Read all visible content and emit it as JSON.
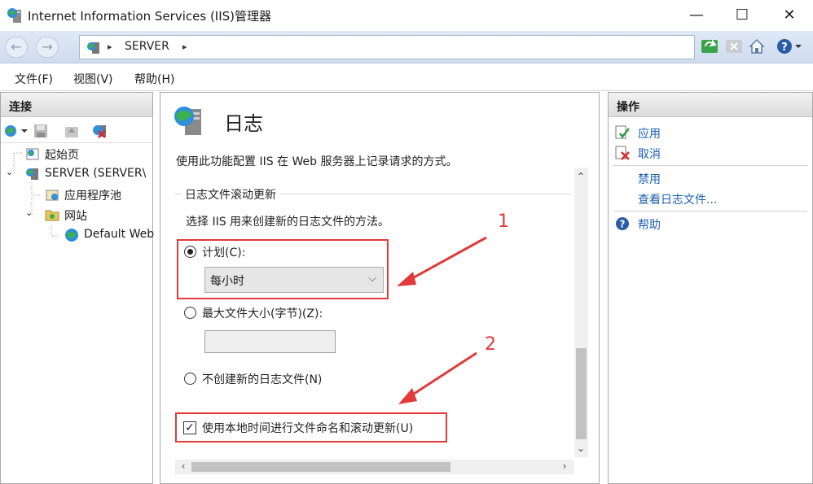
{
  "window": {
    "title": "Internet Information Services (IIS)管理器",
    "minimize": "—",
    "maximize": "☐",
    "close": "✕"
  },
  "addressbar": {
    "back": "←",
    "forward": "→",
    "crumbs": [
      "SERVER"
    ],
    "separator": "▸"
  },
  "menu": {
    "items": [
      "文件(F)",
      "视图(V)",
      "帮助(H)"
    ]
  },
  "connections": {
    "header": "连接",
    "tree": [
      {
        "label": "起始页"
      },
      {
        "label": "SERVER (SERVER\\"
      },
      {
        "label": "应用程序池"
      },
      {
        "label": "网站"
      },
      {
        "label": "Default Web"
      }
    ]
  },
  "center": {
    "title": "日志",
    "description": "使用此功能配置 IIS 在 Web 服务器上记录请求的方式。",
    "group_title": "日志文件滚动更新",
    "group_desc": "选择 IIS 用来创建新的日志文件的方法。",
    "option_schedule": "计划(C):",
    "schedule_value": "每小时",
    "option_maxsize": "最大文件大小(字节)(Z):",
    "maxsize_value": "",
    "option_none": "不创建新的日志文件(N)",
    "option_localtime": "使用本地时间进行文件命名和滚动更新(U)",
    "annotation1": "1",
    "annotation2": "2"
  },
  "actions": {
    "header": "操作",
    "apply": "应用",
    "cancel": "取消",
    "disable": "禁用",
    "view_logs": "查看日志文件...",
    "help": "帮助"
  },
  "colors": {
    "accent_link": "#1a5fb4",
    "annotation_red": "#e03a3a"
  }
}
